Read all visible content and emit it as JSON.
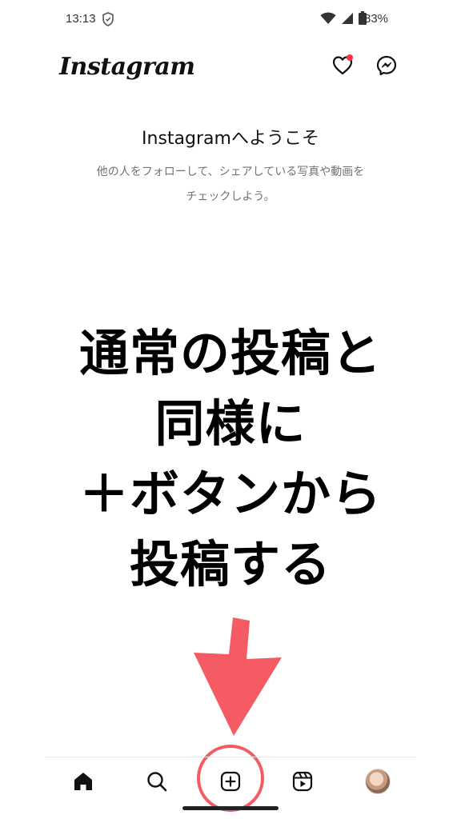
{
  "status_bar": {
    "time": "13:13",
    "battery": "83%",
    "icons": [
      "shield-icon",
      "wifi-icon",
      "signal-icon",
      "battery-icon"
    ]
  },
  "header": {
    "logo": "Instagram",
    "icons": [
      "heart-icon",
      "messenger-icon"
    ],
    "notification_dot_color": "#ff3040"
  },
  "welcome": {
    "title": "Instagramへようこそ",
    "subtitle_line1": "他の人をフォローして、シェアしている写真や動画を",
    "subtitle_line2": "チェックしよう。"
  },
  "overlay": {
    "line1": "通常の投稿と",
    "line2": "同様に",
    "line3": "＋ボタンから",
    "line4": "投稿する",
    "accent_color": "#f45b63"
  },
  "bottom_nav": {
    "items": [
      "home-icon",
      "search-icon",
      "create-icon",
      "reels-icon",
      "profile-avatar"
    ]
  }
}
